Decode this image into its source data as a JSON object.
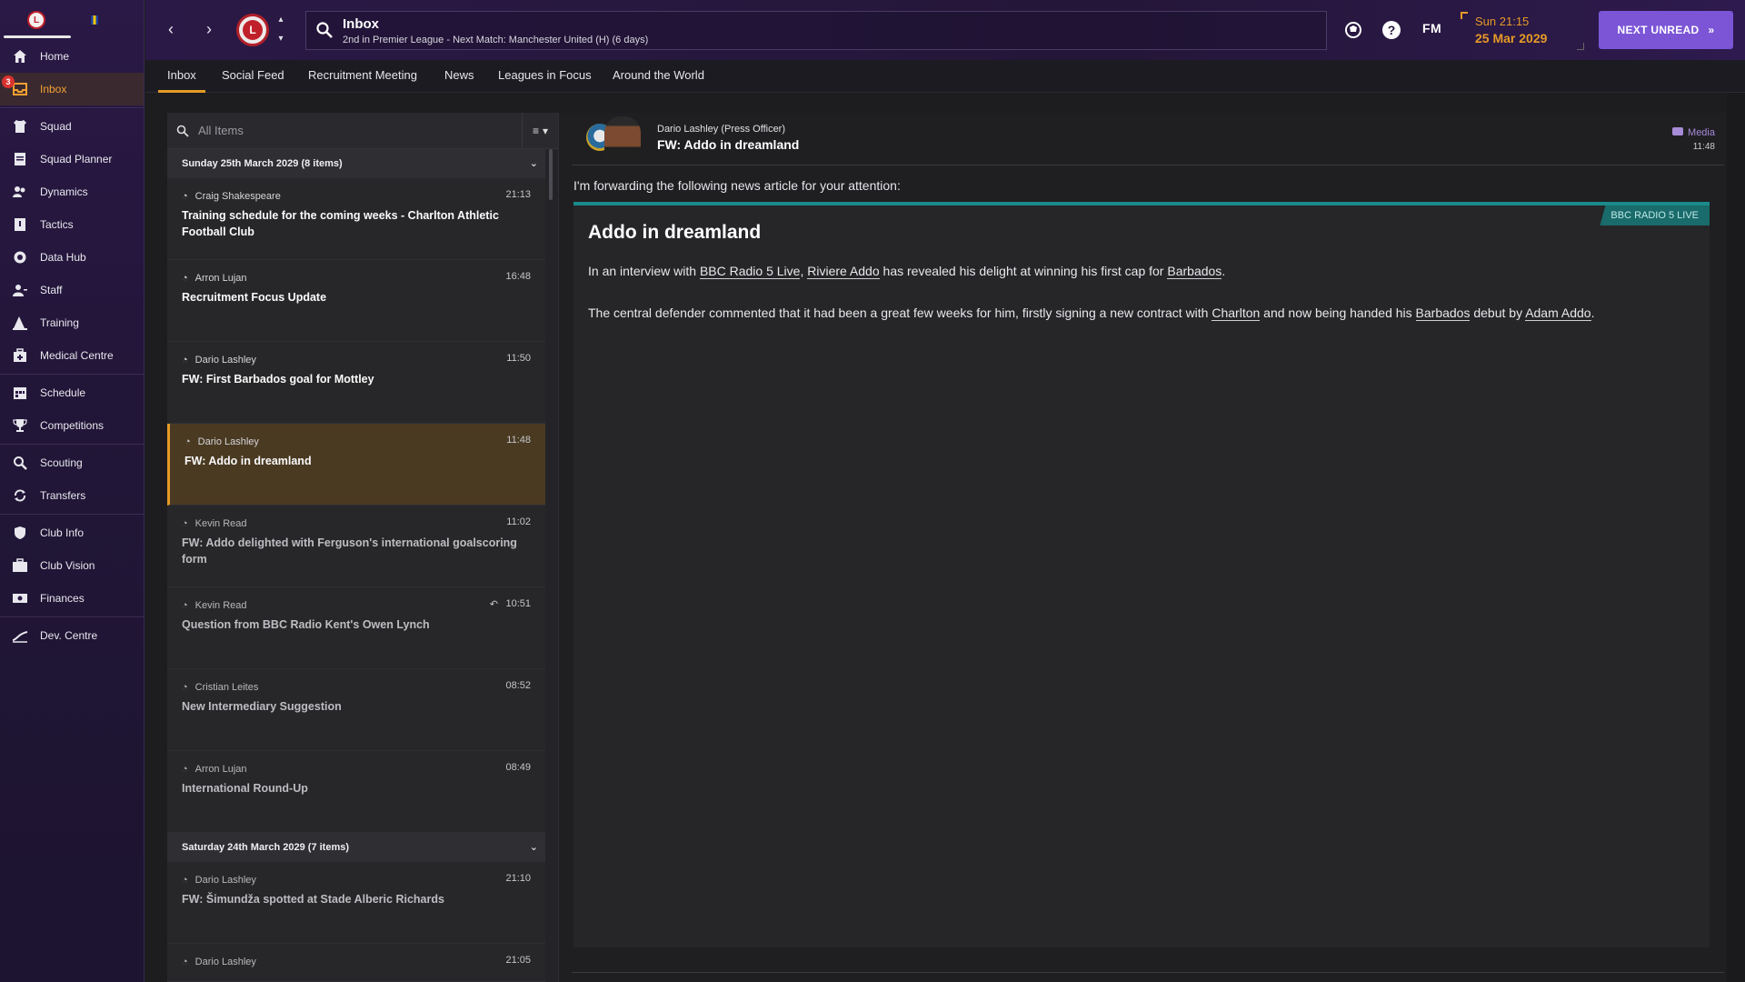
{
  "sidebar": {
    "inbox_badge": "3",
    "items": [
      {
        "label": "Home",
        "icon": "home-icon"
      },
      {
        "label": "Inbox",
        "icon": "inbox-icon"
      },
      {
        "label": "Squad",
        "icon": "shirt-icon"
      },
      {
        "label": "Squad Planner",
        "icon": "clipboard-icon"
      },
      {
        "label": "Dynamics",
        "icon": "people-icon"
      },
      {
        "label": "Tactics",
        "icon": "tactics-board-icon"
      },
      {
        "label": "Data Hub",
        "icon": "data-hub-icon"
      },
      {
        "label": "Staff",
        "icon": "staff-icon"
      },
      {
        "label": "Training",
        "icon": "training-cone-icon"
      },
      {
        "label": "Medical Centre",
        "icon": "medical-kit-icon"
      },
      {
        "label": "Schedule",
        "icon": "calendar-icon"
      },
      {
        "label": "Competitions",
        "icon": "trophy-icon"
      },
      {
        "label": "Scouting",
        "icon": "magnifier-icon"
      },
      {
        "label": "Transfers",
        "icon": "transfer-arrows-icon"
      },
      {
        "label": "Club Info",
        "icon": "shield-icon"
      },
      {
        "label": "Club Vision",
        "icon": "briefcase-icon"
      },
      {
        "label": "Finances",
        "icon": "money-icon"
      },
      {
        "label": "Dev. Centre",
        "icon": "growth-icon"
      }
    ]
  },
  "header": {
    "title": "Inbox",
    "subtitle": "2nd in Premier League - Next Match: Manchester United (H) (6 days)",
    "time": "Sun 21:15",
    "date": "25 Mar 2029",
    "logo": "FM",
    "next_unread": "NEXT UNREAD"
  },
  "tabs": [
    "Inbox",
    "Social Feed",
    "Recruitment Meeting",
    "News",
    "Leagues in Focus",
    "Around the World"
  ],
  "list": {
    "search_placeholder": "All Items",
    "group1": "Sunday 25th March 2029 (8 items)",
    "group2": "Saturday 24th March 2029 (7 items)",
    "messages": [
      {
        "from": "Craig Shakespeare",
        "time": "21:13",
        "subject": "Training schedule for the coming weeks - Charlton Athletic Football Club"
      },
      {
        "from": "Arron Lujan",
        "time": "16:48",
        "subject": "Recruitment Focus Update"
      },
      {
        "from": "Dario Lashley",
        "time": "11:50",
        "subject": "FW: First Barbados goal for Mottley"
      },
      {
        "from": "Dario Lashley",
        "time": "11:48",
        "subject": "FW: Addo in dreamland"
      },
      {
        "from": "Kevin Read",
        "time": "11:02",
        "subject": "FW: Addo delighted with Ferguson's international goalscoring form"
      },
      {
        "from": "Kevin Read",
        "time": "10:51",
        "subject": "Question from BBC Radio Kent's Owen Lynch"
      },
      {
        "from": "Cristian Leites",
        "time": "08:52",
        "subject": "New Intermediary Suggestion"
      },
      {
        "from": "Arron Lujan",
        "time": "08:49",
        "subject": "International Round-Up"
      },
      {
        "from": "Dario Lashley",
        "time": "21:10",
        "subject": "FW: Šimundža spotted at Stade Alberic Richards"
      },
      {
        "from": "Dario Lashley",
        "time": "21:05",
        "subject": ""
      }
    ]
  },
  "reader": {
    "sender": "Dario Lashley  (Press Officer)",
    "subject": "FW: Addo in dreamland",
    "category": "Media",
    "time": "11:48",
    "intro": "I'm forwarding the following news article for your attention:",
    "source": "BBC RADIO 5 LIVE",
    "article_title": "Addo in dreamland",
    "p1_a": "In an interview with ",
    "p1_link1": "BBC Radio 5 Live",
    "p1_b": ", ",
    "p1_link2": "Riviere Addo",
    "p1_c": " has revealed his delight at winning his first cap for ",
    "p1_link3": "Barbados",
    "p1_d": ".",
    "p2_a": "The central defender commented that it had been a great few weeks for him, firstly signing a new contract with ",
    "p2_link1": "Charlton",
    "p2_b": " and now being handed his ",
    "p2_link2": "Barbados",
    "p2_c": " debut by ",
    "p2_link3": "Adam Addo",
    "p2_d": "."
  },
  "colors": {
    "accent": "#e59a26",
    "purple": "#7b55d6",
    "teal": "#1a8a8a"
  }
}
